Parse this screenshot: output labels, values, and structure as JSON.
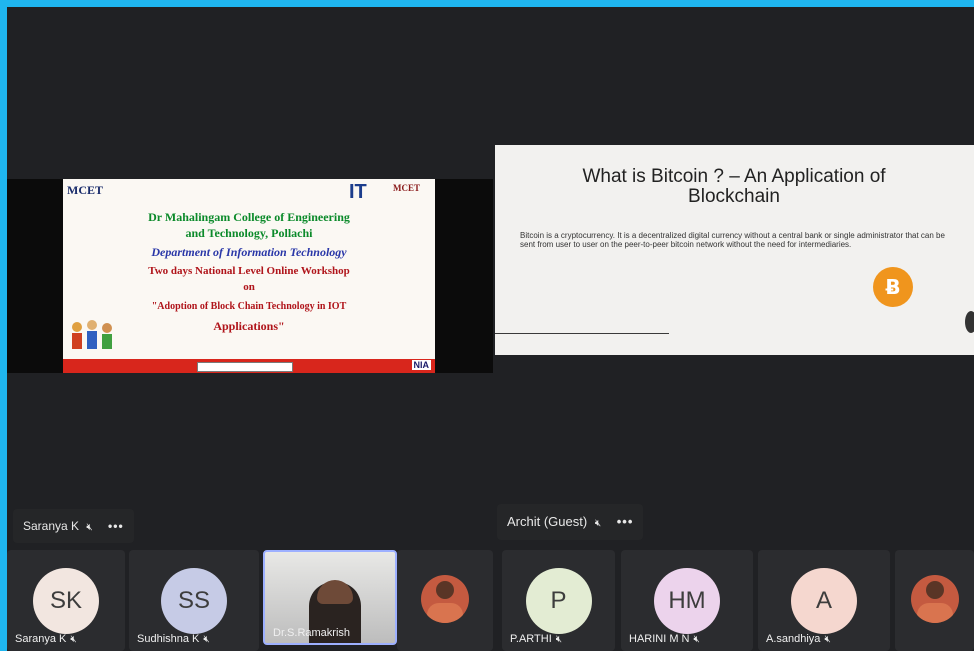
{
  "left_pane": {
    "slide": {
      "logo_left": "MCET",
      "logo_it": "IT",
      "logo_right": "MCET",
      "college_line1": "Dr Mahalingam College of Engineering",
      "college_line2": "and Technology, Pollachi",
      "department": "Department of Information Technology",
      "workshop": "Two days National Level Online Workshop",
      "on": "on",
      "topic_line1": "\"Adoption of Block Chain Technology in IOT",
      "topic_line2": "Applications\"",
      "footer_logo": "NIA"
    },
    "presenter": {
      "name": "Saranya K",
      "more": "•••"
    },
    "tiles": [
      {
        "initials": "SK",
        "name": "Saranya K",
        "avatar_color": "#f2e6e0"
      },
      {
        "initials": "SS",
        "name": "Sudhishna K",
        "avatar_color": "#c6cbe6"
      },
      {
        "name": "Dr.S.Ramakrish",
        "type": "video"
      },
      {
        "type": "photo"
      }
    ]
  },
  "right_pane": {
    "slide": {
      "title_line1": "What is Bitcoin ? – An Application of",
      "title_line2": "Blockchain",
      "body": "Bitcoin is a cryptocurrency. It is a decentralized digital currency without a central bank or single administrator that can be sent from user to user on the peer-to-peer bitcoin network without the need for intermediaries.",
      "bitcoin_symbol": "Ƀ"
    },
    "presenter": {
      "name": "Archit (Guest)",
      "more": "•••"
    },
    "tiles": [
      {
        "initials": "P",
        "name": "P.ARTHI",
        "avatar_color": "#e3ecd3"
      },
      {
        "initials": "HM",
        "name": "HARINI  M N",
        "avatar_color": "#ecd3ec"
      },
      {
        "initials": "A",
        "name": "A.sandhiya",
        "avatar_color": "#f5d7cf"
      },
      {
        "type": "photo"
      }
    ]
  },
  "icons": {
    "mic_off": "mic-off-icon",
    "more": "more-options-icon"
  },
  "colors": {
    "background": "#202124",
    "border": "#1fb6f0",
    "bitcoin": "#f0951d"
  }
}
